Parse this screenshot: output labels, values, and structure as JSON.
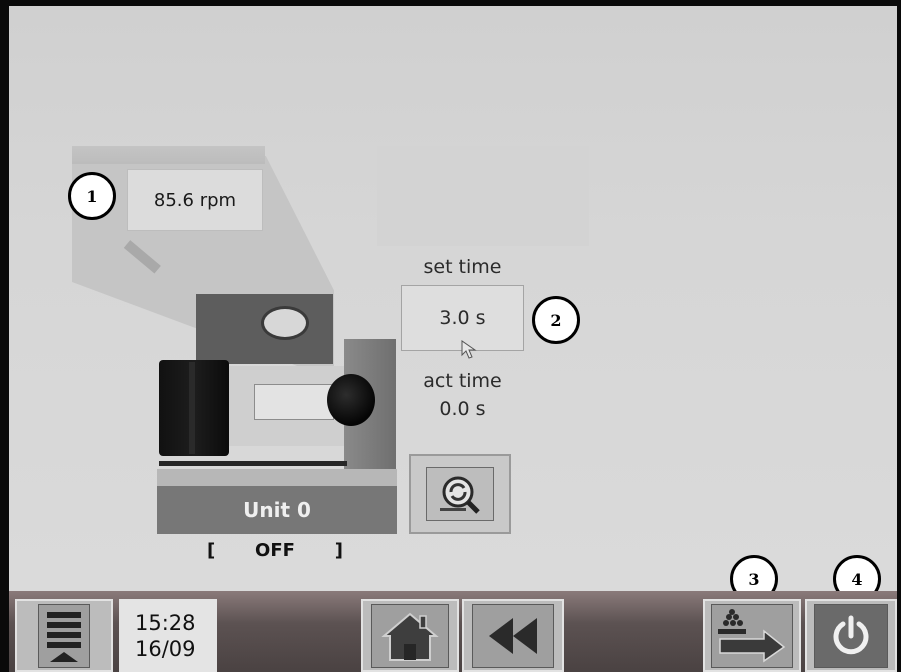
{
  "machine": {
    "speed_value": "85.6 rpm",
    "unit_name": "Unit 0",
    "state_open": "[",
    "state_text": "OFF",
    "state_close": "]"
  },
  "timer": {
    "set_label": "set time",
    "set_value": "3.0 s",
    "act_label": "act time",
    "act_value": "0.0 s"
  },
  "callouts": [
    "1",
    "2",
    "3",
    "4"
  ],
  "taskbar": {
    "time": "15:28",
    "date": "16/09"
  },
  "icons": {
    "menu": "menu-list-icon",
    "home": "home-icon",
    "back": "rewind-icon",
    "transfer": "transfer-arrow-icon",
    "power": "power-icon",
    "reset": "reset-magnifier-icon"
  },
  "colors": {
    "screen_bg": "#d6d6d6",
    "unit_bar": "#777777",
    "taskbar": "#5c5252"
  }
}
